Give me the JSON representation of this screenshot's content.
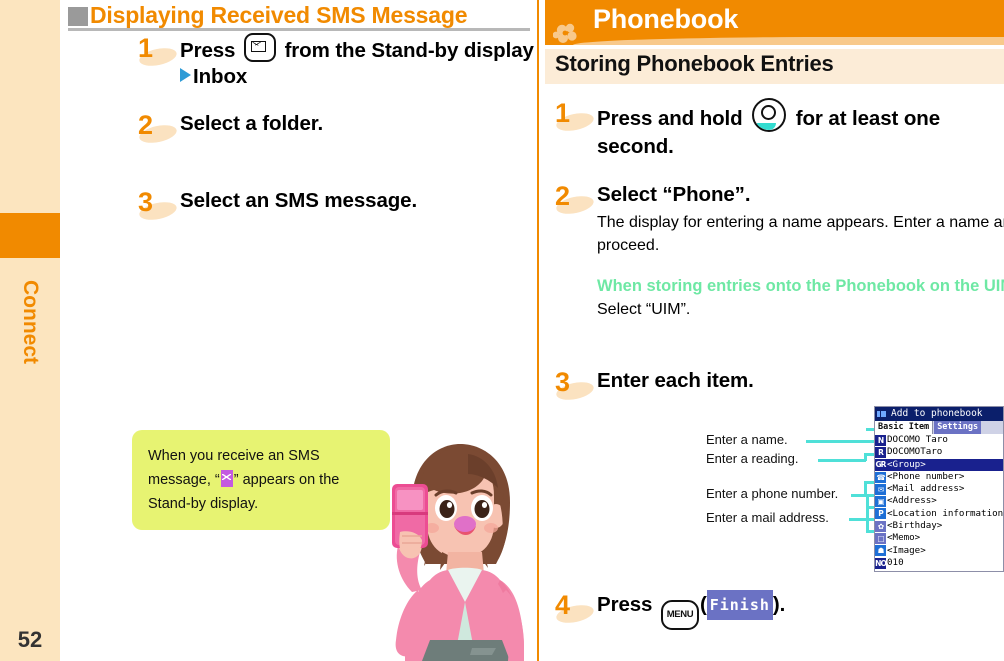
{
  "sidebar": {
    "label": "Connect",
    "page_number": "52"
  },
  "left_panel": {
    "title": "Displaying Received SMS Message",
    "steps": [
      {
        "num": "1",
        "head_pre": "Press",
        "head_icon": "envelope-key-icon",
        "head_post": "from the Stand-by display",
        "head_line2": "Inbox"
      },
      {
        "num": "2",
        "head": "Select a folder."
      },
      {
        "num": "3",
        "head": "Select an SMS message."
      }
    ],
    "callout": {
      "line1": "When you receive an SMS",
      "line2_pre": "message, “",
      "line2_post": "” appears on the",
      "line3": "Stand-by display."
    }
  },
  "right_panel": {
    "chapter_title": "Phonebook",
    "section_title": "Storing Phonebook Entries",
    "steps": [
      {
        "num": "1",
        "head_pre": "Press and hold",
        "head_icon": "nav-circle-key-icon",
        "head_post": "for at least one",
        "head_line2": "second."
      },
      {
        "num": "2",
        "head": "Select “Phone”.",
        "sub": "The display for entering a name appears. Enter a name and proceed.",
        "green_head": "When storing entries onto the Phonebook on the UIM",
        "green_sub": "Select “UIM”."
      },
      {
        "num": "3",
        "head": "Enter each item."
      },
      {
        "num": "4",
        "head_pre": "Press",
        "head_icon": "menu-key-icon",
        "menu_label": "MENU",
        "paren_open": "(",
        "softkey": "Finish",
        "paren_close": ")."
      }
    ],
    "leader_labels": [
      "Enter a name.",
      "Enter a reading.",
      "Enter a phone number.",
      "Enter a mail address."
    ]
  },
  "phone_screen": {
    "title": "Add to phonebook",
    "tabs": [
      {
        "label": "Basic Item",
        "active": true
      },
      {
        "label": "Settings",
        "active": false
      }
    ],
    "rows": [
      {
        "icon": "N",
        "icon_bg": "#19218e",
        "text": "DOCOMO Taro",
        "selected": false
      },
      {
        "icon": "R",
        "icon_bg": "#19218e",
        "text": "DOCOMOTaro",
        "selected": false
      },
      {
        "icon": "GR",
        "icon_bg": "#19218e",
        "text": "<Group>",
        "selected": true
      },
      {
        "icon": "☎",
        "icon_bg": "#1e6fd6",
        "text": "<Phone number>",
        "selected": false
      },
      {
        "icon": "✉",
        "icon_bg": "#1e6fd6",
        "text": "<Mail address>",
        "selected": false
      },
      {
        "icon": "▣",
        "icon_bg": "#1e6fd6",
        "text": "<Address>",
        "selected": false
      },
      {
        "icon": "P",
        "icon_bg": "#1e6fd6",
        "text": "<Location information>",
        "selected": false
      },
      {
        "icon": "✿",
        "icon_bg": "#6b72c4",
        "text": "<Birthday>",
        "selected": false
      },
      {
        "icon": "□",
        "icon_bg": "#6b72c4",
        "text": "<Memo>",
        "selected": false
      },
      {
        "icon": "☗",
        "icon_bg": "#1e6fd6",
        "text": "<Image>",
        "selected": false
      },
      {
        "icon": "NO",
        "icon_bg": "#19218e",
        "text": "010",
        "selected": false
      }
    ]
  },
  "colors": {
    "accent_orange": "#f18a00",
    "sidebar_bg": "#fce5bf",
    "section_bg": "#fcecd7",
    "callout_bg": "#e7f372",
    "green_heading": "#6ee8a4",
    "leader_teal": "#4fe0d8",
    "softkey_blue": "#6b72c4"
  }
}
